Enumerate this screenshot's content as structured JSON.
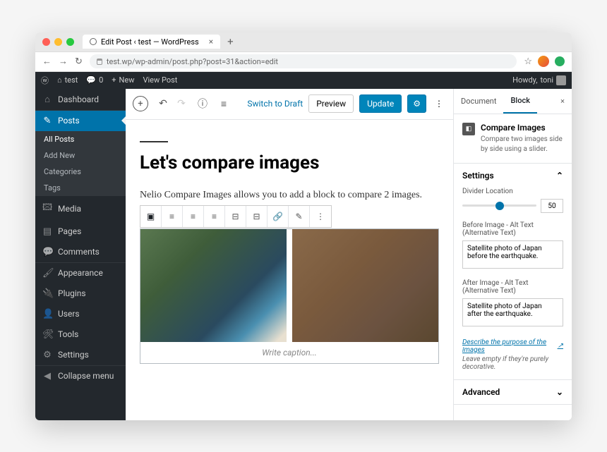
{
  "browser": {
    "tab_title": "Edit Post ‹ test — WordPress",
    "url": "test.wp/wp-admin/post.php?post=31&action=edit"
  },
  "adminbar": {
    "site": "test",
    "comments": "0",
    "new": "New",
    "view": "View Post",
    "howdy_prefix": "Howdy,",
    "user": "toni"
  },
  "sidebar": {
    "items": [
      {
        "label": "Dashboard",
        "icon": "⌂"
      },
      {
        "label": "Posts",
        "icon": "✎",
        "current": true
      },
      {
        "label": "Media",
        "icon": "🖾"
      },
      {
        "label": "Pages",
        "icon": "▤"
      },
      {
        "label": "Comments",
        "icon": "💬"
      },
      {
        "label": "Appearance",
        "icon": "🖌"
      },
      {
        "label": "Plugins",
        "icon": "🔌"
      },
      {
        "label": "Users",
        "icon": "👤"
      },
      {
        "label": "Tools",
        "icon": "🛠"
      },
      {
        "label": "Settings",
        "icon": "⚙"
      },
      {
        "label": "Collapse menu",
        "icon": "◀"
      }
    ],
    "submenu": [
      "All Posts",
      "Add New",
      "Categories",
      "Tags"
    ]
  },
  "editor": {
    "switch_draft": "Switch to Draft",
    "preview": "Preview",
    "update": "Update",
    "title": "Let's compare images",
    "paragraph": "Nelio Compare Images allows you to add a block to compare 2 images.",
    "caption_placeholder": "Write caption..."
  },
  "inspector": {
    "tabs": {
      "document": "Document",
      "block": "Block"
    },
    "block_name": "Compare Images",
    "block_desc": "Compare two images side by side using a slider.",
    "settings_title": "Settings",
    "divider_label": "Divider Location",
    "divider_value": "50",
    "before_alt_label": "Before Image - Alt Text (Alternative Text)",
    "before_alt_value": "Satellite photo of Japan before the earthquake.",
    "after_alt_label": "After Image - Alt Text (Alternative Text)",
    "after_alt_value": "Satellite photo of Japan after the earthquake.",
    "describe_link": "Describe the purpose of the images",
    "hint": "Leave empty if they're purely decorative.",
    "advanced_title": "Advanced"
  }
}
